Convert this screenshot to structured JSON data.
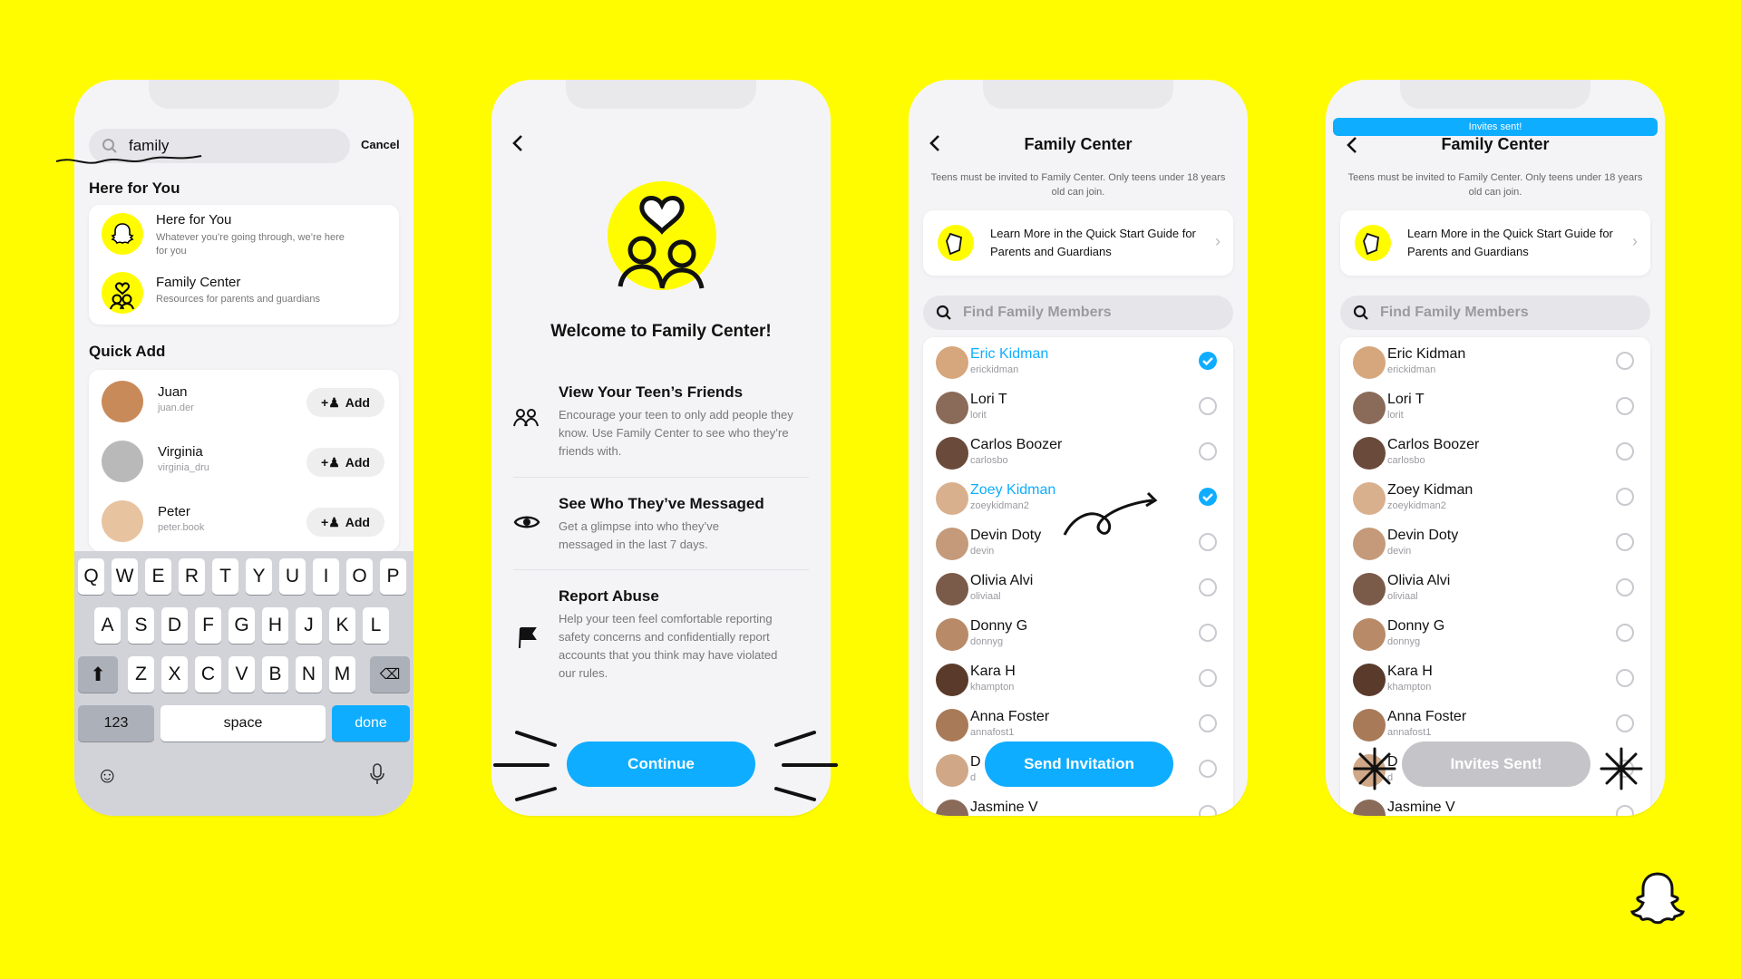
{
  "brand": {
    "yellow": "#FFFC00",
    "blue": "#0fadff"
  },
  "screen1": {
    "search_value": "family",
    "cancel": "Cancel",
    "section_here": "Here for You",
    "results": [
      {
        "title": "Here for You",
        "subtitle": "Whatever you’re going through, we’re here for you",
        "icon": "snapchat-ghost-icon"
      },
      {
        "title": "Family Center",
        "subtitle": "Resources for parents and guardians",
        "icon": "family-center-icon"
      }
    ],
    "section_quick": "Quick Add",
    "quick_add": [
      {
        "name": "Juan",
        "username": "juan.der",
        "button": "Add"
      },
      {
        "name": "Virginia",
        "username": "virginia_dru",
        "button": "Add"
      },
      {
        "name": "Peter",
        "username": "peter.book",
        "button": "Add"
      }
    ],
    "keyboard": {
      "row1": [
        "Q",
        "W",
        "E",
        "R",
        "T",
        "Y",
        "U",
        "I",
        "O",
        "P"
      ],
      "row2": [
        "A",
        "S",
        "D",
        "F",
        "G",
        "H",
        "J",
        "K",
        "L"
      ],
      "row3": [
        "Z",
        "X",
        "C",
        "V",
        "B",
        "N",
        "M"
      ],
      "num": "123",
      "space": "space",
      "done": "done"
    }
  },
  "screen2": {
    "title": "Welcome to Family Center!",
    "features": [
      {
        "title": "View Your Teen’s Friends",
        "body": "Encourage your teen to only add people they know. Use Family Center to see who they’re friends with.",
        "icon": "friends-icon"
      },
      {
        "title": "See Who They’ve Messaged",
        "body": "Get a glimpse into who they’ve messaged in the last 7 days.",
        "icon": "eye-icon"
      },
      {
        "title": "Report Abuse",
        "body": "Help your teen feel comfortable reporting safety concerns and confidentially report accounts that you think may have violated our rules.",
        "icon": "flag-icon"
      }
    ],
    "button": "Continue"
  },
  "family": {
    "title": "Family Center",
    "note": "Teens must be invited to Family Center. Only teens under 18 years old can join.",
    "guide": "Learn More in the Quick Start Guide for Parents and Guardians",
    "search_placeholder": "Find Family Members",
    "members": [
      {
        "name": "Eric Kidman",
        "username": "erickidman"
      },
      {
        "name": "Lori T",
        "username": "lorit"
      },
      {
        "name": "Carlos Boozer",
        "username": "carlosbo"
      },
      {
        "name": "Zoey Kidman",
        "username": "zoeykidman2"
      },
      {
        "name": "Devin Doty",
        "username": "devin"
      },
      {
        "name": "Olivia Alvi",
        "username": "oliviaal"
      },
      {
        "name": "Donny G",
        "username": "donnyg"
      },
      {
        "name": "Kara H",
        "username": "khampton"
      },
      {
        "name": "Anna Foster",
        "username": "annafost1"
      },
      {
        "name": "D",
        "username": "d"
      },
      {
        "name": "Jasmine V",
        "username": ""
      }
    ]
  },
  "screen3": {
    "selected": [
      "Eric Kidman",
      "Zoey Kidman"
    ],
    "button": "Send Invitation"
  },
  "screen4": {
    "banner": "Invites sent!",
    "button": "Invites Sent!"
  }
}
